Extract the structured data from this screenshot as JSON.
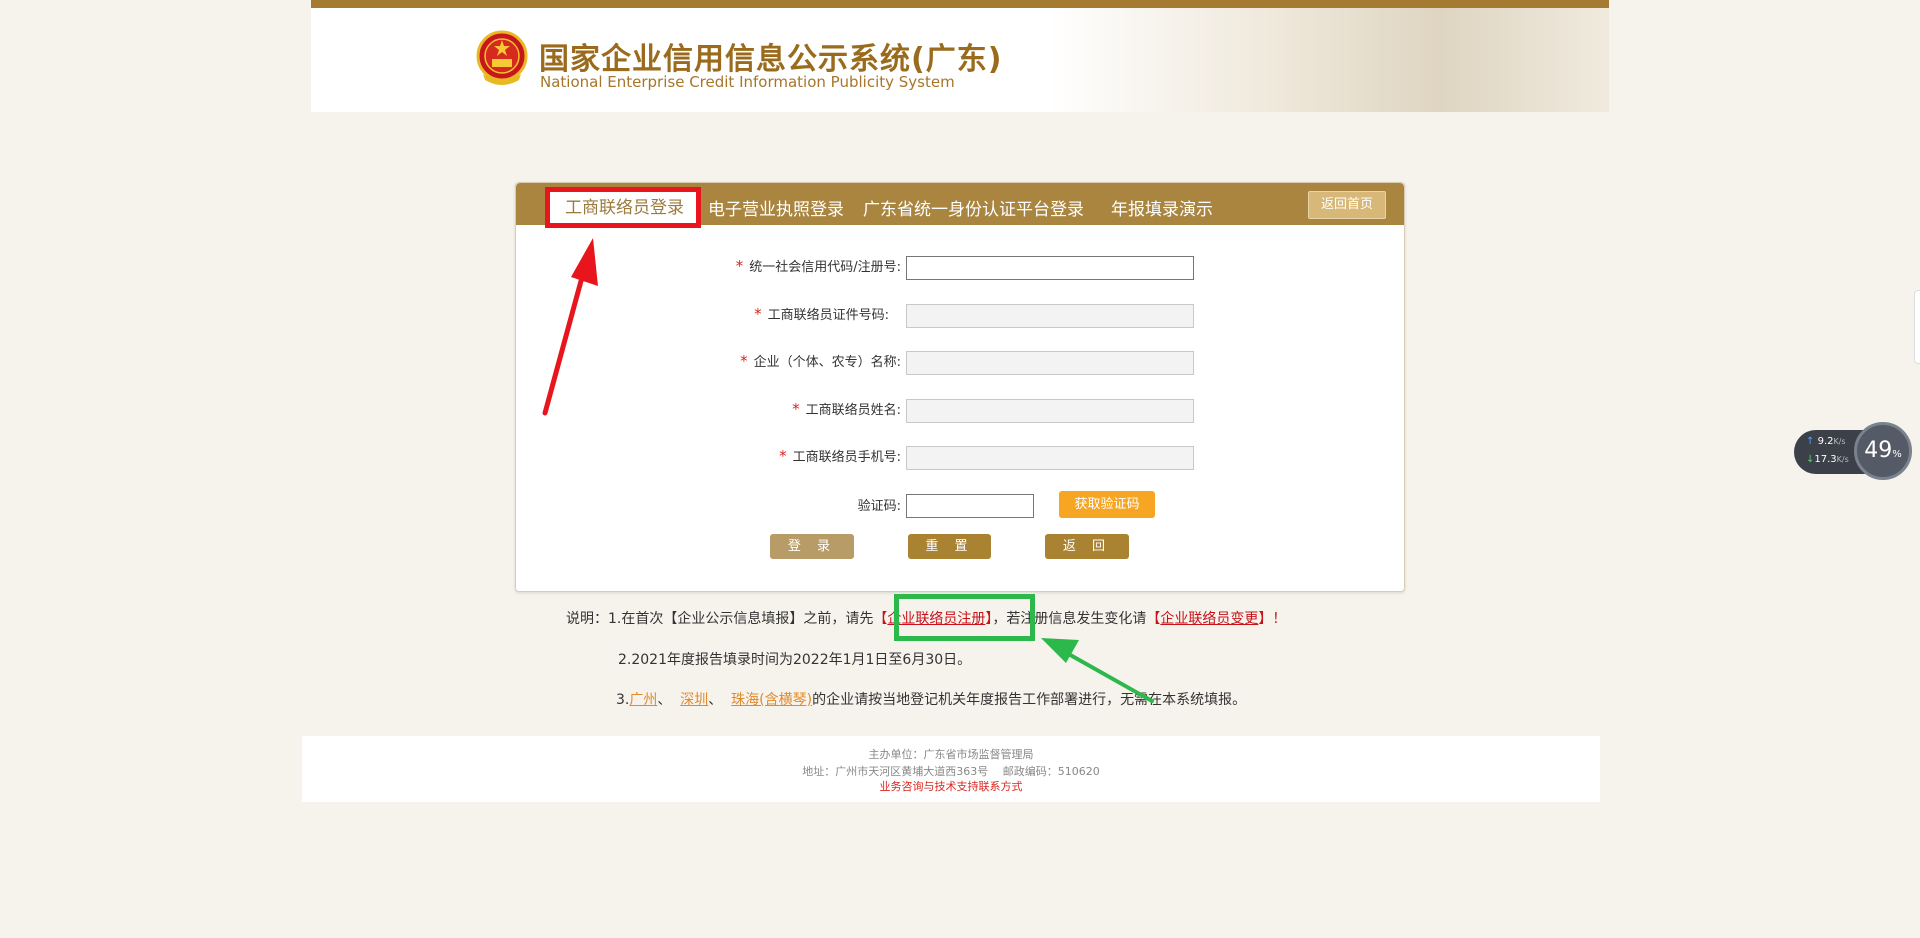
{
  "header": {
    "title": "国家企业信用信息公示系统(广东)",
    "subtitle": "National Enterprise Credit Information Publicity System"
  },
  "tabs": [
    {
      "label": "工商联络员登录",
      "active": true
    },
    {
      "label": "电子营业执照登录",
      "active": false
    },
    {
      "label": "广东省统一身份认证平台登录",
      "active": false
    },
    {
      "label": "年报填录演示",
      "active": false
    }
  ],
  "back_home": "返回首页",
  "form": {
    "credit_code_label": "统一社会信用代码/注册号:",
    "id_number_label": "工商联络员证件号码:",
    "company_name_label": "企业（个体、农专）名称:",
    "contact_name_label": "工商联络员姓名:",
    "contact_phone_label": "工商联络员手机号:",
    "captcha_label": "验证码:",
    "required_mark": "*",
    "get_code": "获取验证码",
    "login": "登 录",
    "reset": "重 置",
    "return": "返 回"
  },
  "notes": {
    "line1_prefix": "说明：1.在首次【企业公示信息填报】之前，请先",
    "line1_link1": "企业联络员注册",
    "line1_middle": "，若注册信息发生变化请",
    "line1_link2": "企业联络员变更",
    "line1_suffix": "！",
    "bracket_open": "【",
    "bracket_close": "】",
    "line2": "2.2021年度报告填录时间为2022年1月1日至6月30日。",
    "line3_prefix": "3.",
    "city1": "广州",
    "sep": "、",
    "city2": "深圳",
    "city3": "珠海(含横琴)",
    "line3_suffix": "的企业请按当地登记机关年度报告工作部署进行，无需在本系统填报。"
  },
  "footer": {
    "sponsor": "主办单位：广东省市场监督管理局",
    "address": "地址：广州市天河区黄埔大道西363号　 邮政编码：510620",
    "contact": "业务咨询与技术支持联系方式"
  },
  "speed_widget": {
    "up": "9.2",
    "down": "17.3",
    "unit": "K/s",
    "percent": "49",
    "percent_sign": "%"
  },
  "colors": {
    "brand_gold": "#a98540",
    "required_red": "#d9251d",
    "annotation_red": "#e8161c",
    "annotation_green": "#2db84c"
  }
}
